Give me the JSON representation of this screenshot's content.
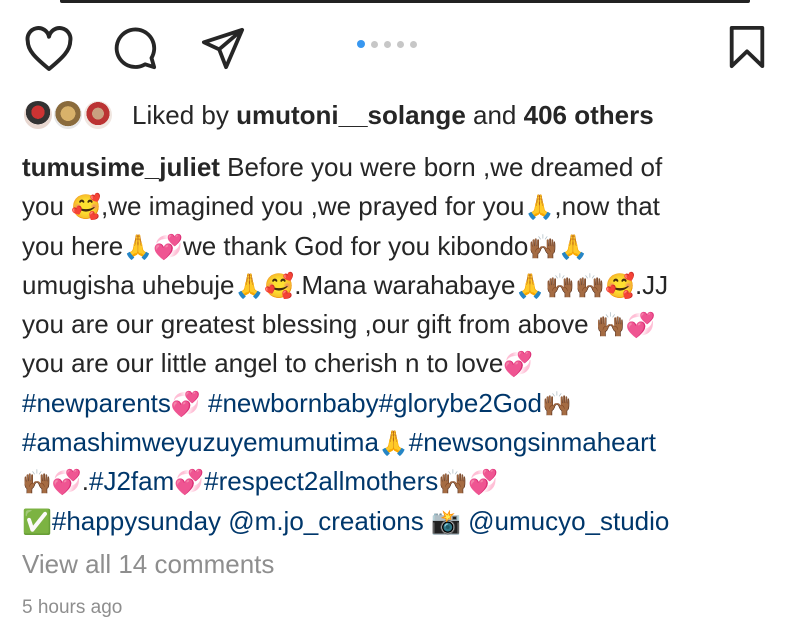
{
  "actions": {
    "like_icon": "heart-outline-icon",
    "comment_icon": "speech-bubble-icon",
    "share_icon": "paper-plane-icon",
    "save_icon": "bookmark-icon",
    "carousel": {
      "total": 5,
      "active": 1
    }
  },
  "likes": {
    "prefix": "Liked by",
    "user": "umutoni__solange",
    "and": "and",
    "others": "406 others"
  },
  "caption": {
    "username": "tumusime_juliet",
    "lines": [
      [
        {
          "t": "text",
          "v": "Before you were born ,we dreamed of"
        }
      ],
      [
        {
          "t": "text",
          "v": "you "
        },
        {
          "t": "emoji",
          "v": "🥰"
        },
        {
          "t": "text",
          "v": ",we imagined you ,we prayed for you"
        },
        {
          "t": "emoji",
          "v": "🙏"
        },
        {
          "t": "text",
          "v": ",now that"
        }
      ],
      [
        {
          "t": "text",
          "v": "you here"
        },
        {
          "t": "emoji",
          "v": "🙏💞"
        },
        {
          "t": "text",
          "v": "we thank God for you kibondo"
        },
        {
          "t": "emoji",
          "v": "🙌🏾🙏"
        }
      ],
      [
        {
          "t": "text",
          "v": "umugisha uhebuje"
        },
        {
          "t": "emoji",
          "v": "🙏🥰"
        },
        {
          "t": "text",
          "v": ".Mana warahabaye"
        },
        {
          "t": "emoji",
          "v": "🙏🙌🏾🙌🏾🥰"
        },
        {
          "t": "text",
          "v": ".JJ"
        }
      ],
      [
        {
          "t": "text",
          "v": "you are our greatest blessing ,our gift from above "
        },
        {
          "t": "emoji",
          "v": "🙌🏾💞"
        }
      ],
      [
        {
          "t": "text",
          "v": "you are our little angel to cherish n  to love"
        },
        {
          "t": "emoji",
          "v": "💞"
        }
      ],
      [
        {
          "t": "tag",
          "v": "#newparents"
        },
        {
          "t": "emoji",
          "v": "💞"
        },
        {
          "t": "text",
          "v": " "
        },
        {
          "t": "tag",
          "v": "#newbornbaby#glorybe2God"
        },
        {
          "t": "emoji",
          "v": "🙌🏾"
        }
      ],
      [
        {
          "t": "tag",
          "v": "#amashimweyuzuyemumutima"
        },
        {
          "t": "emoji",
          "v": "🙏"
        },
        {
          "t": "tag",
          "v": "#newsongsinmaheart"
        }
      ],
      [
        {
          "t": "emoji",
          "v": "🙌🏾💞"
        },
        {
          "t": "text",
          "v": "."
        },
        {
          "t": "tag",
          "v": "#J2fam"
        },
        {
          "t": "emoji",
          "v": "💞"
        },
        {
          "t": "tag",
          "v": "#respect2allmothers"
        },
        {
          "t": "emoji",
          "v": "🙌🏾💞"
        }
      ],
      [
        {
          "t": "emoji",
          "v": "✅"
        },
        {
          "t": "tag",
          "v": "#happysunday"
        },
        {
          "t": "text",
          "v": " "
        },
        {
          "t": "tag",
          "v": "@m.jo_creations"
        },
        {
          "t": "text",
          "v": " "
        },
        {
          "t": "emoji",
          "v": "📸"
        },
        {
          "t": "text",
          "v": " "
        },
        {
          "t": "tag",
          "v": "@umucyo_studio"
        }
      ]
    ]
  },
  "comments": {
    "view_all": "View all 14 comments"
  },
  "timestamp": "5 hours ago",
  "colors": {
    "text": "#262626",
    "tag": "#00376b",
    "muted": "#8e8e8e",
    "accent": "#3897f0"
  }
}
